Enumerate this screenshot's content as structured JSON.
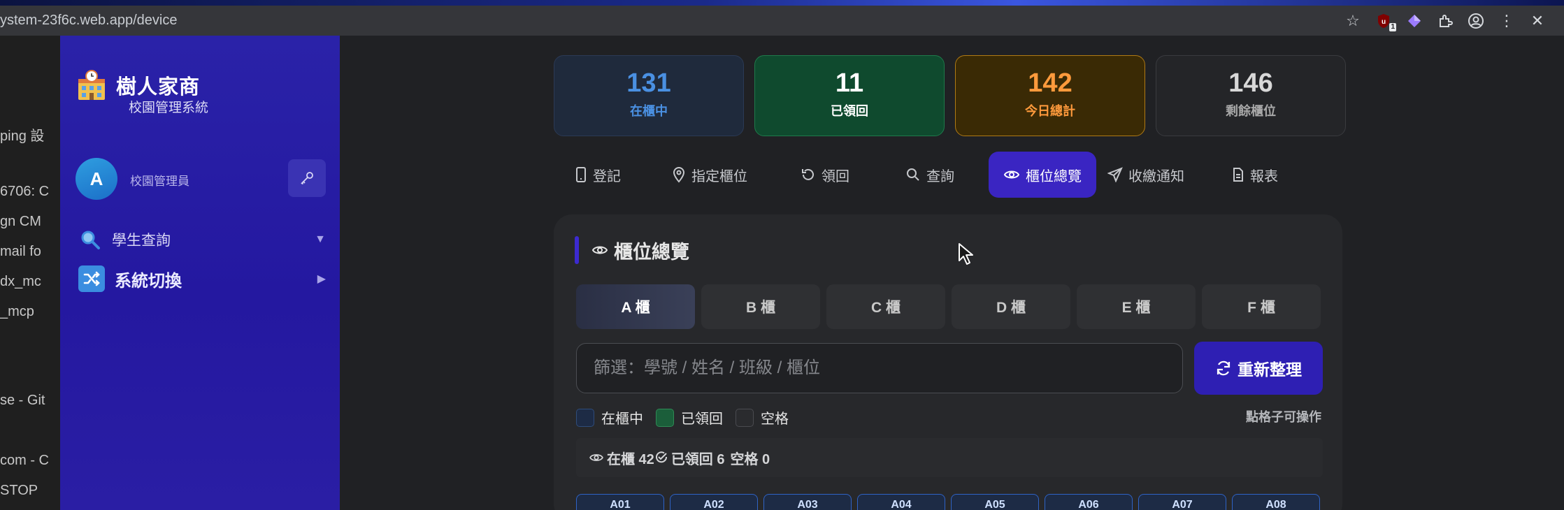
{
  "browser": {
    "url": "ystem-23f6c.web.app/device",
    "extension_badge": "1"
  },
  "behind_window_items": [
    "ping 設",
    "6706: C",
    "gn CM",
    "mail fo",
    "dx_mc",
    "_mcp",
    "se - Git",
    "com - C",
    "STOP"
  ],
  "sidebar": {
    "brand_title": "樹人家商",
    "brand_subtitle": "校園管理系統",
    "user": {
      "avatar_letter": "A",
      "role": "校園管理員"
    },
    "nav": [
      {
        "label": "學生查詢",
        "icon": "magnifier-icon"
      },
      {
        "label": "系統切換",
        "icon": "shuffle-icon"
      }
    ]
  },
  "stats": [
    {
      "value": "131",
      "label": "在櫃中",
      "color": "#4a90e2"
    },
    {
      "value": "11",
      "label": "已領回",
      "color": "#ffffff"
    },
    {
      "value": "142",
      "label": "今日總計",
      "color": "#ff9a3c"
    },
    {
      "value": "146",
      "label": "剩餘櫃位",
      "color": "#d8d8d8"
    }
  ],
  "tabs": [
    {
      "label": "登記",
      "icon": "phone-icon"
    },
    {
      "label": "指定櫃位",
      "icon": "map-pin-icon"
    },
    {
      "label": "領回",
      "icon": "undo-icon"
    },
    {
      "label": "查詢",
      "icon": "search-icon"
    },
    {
      "label": "櫃位總覽",
      "icon": "eye-icon",
      "active": true
    },
    {
      "label": "收繳通知",
      "icon": "send-icon"
    },
    {
      "label": "報表",
      "icon": "document-icon"
    }
  ],
  "overview": {
    "title": "櫃位總覽",
    "cabinets": [
      "A 櫃",
      "B 櫃",
      "C 櫃",
      "D 櫃",
      "E 櫃",
      "F 櫃"
    ],
    "active_cabinet": "A 櫃",
    "filter_placeholder": "篩選：學號 / 姓名 / 班級 / 櫃位",
    "refresh_label": "重新整理",
    "legend": [
      {
        "label": "在櫃中",
        "color": "#1d2b45"
      },
      {
        "label": "已領回",
        "color": "#1b5e3a"
      },
      {
        "label": "空格",
        "color": "#2a2b2e"
      }
    ],
    "hint": "點格子可操作",
    "summary": {
      "in": "在櫃 42",
      "returned": "已領回 6",
      "empty": "空格 0"
    },
    "slots": [
      "A01",
      "A02",
      "A03",
      "A04",
      "A05",
      "A06",
      "A07",
      "A08"
    ]
  }
}
